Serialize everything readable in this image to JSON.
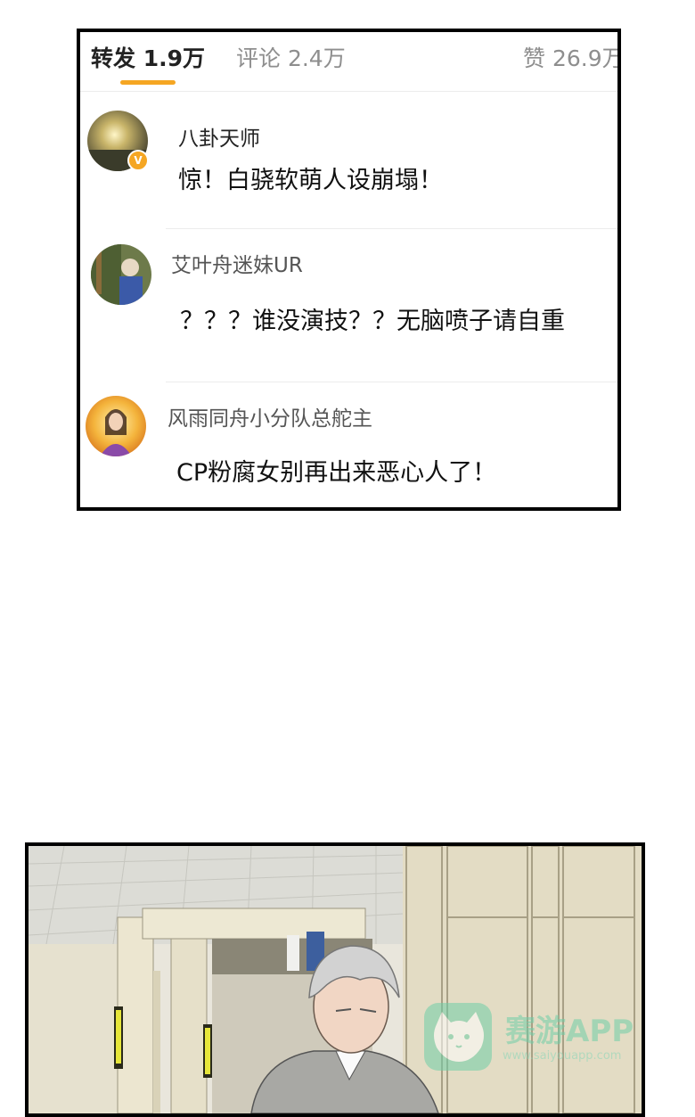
{
  "tabs": {
    "repost": "转发 1.9万",
    "comment": "评论 2.4万",
    "like": "赞 26.9万"
  },
  "comments": [
    {
      "name": "八卦天师",
      "text": "惊！白骁软萌人设崩塌！",
      "verified": true,
      "verified_mark": "V"
    },
    {
      "name": "艾叶舟迷妹UR",
      "text": "？？？谁没演技？？无脑喷子请自重"
    },
    {
      "name": "风雨同舟小分队总舵主",
      "text": "CP粉腐女别再出来恶心人了！"
    }
  ],
  "watermark": {
    "title": "赛游APP",
    "subtitle": "www.saiyouapp.com"
  },
  "colors": {
    "accent": "#f5a623",
    "watermark": "#6fcfa8"
  }
}
